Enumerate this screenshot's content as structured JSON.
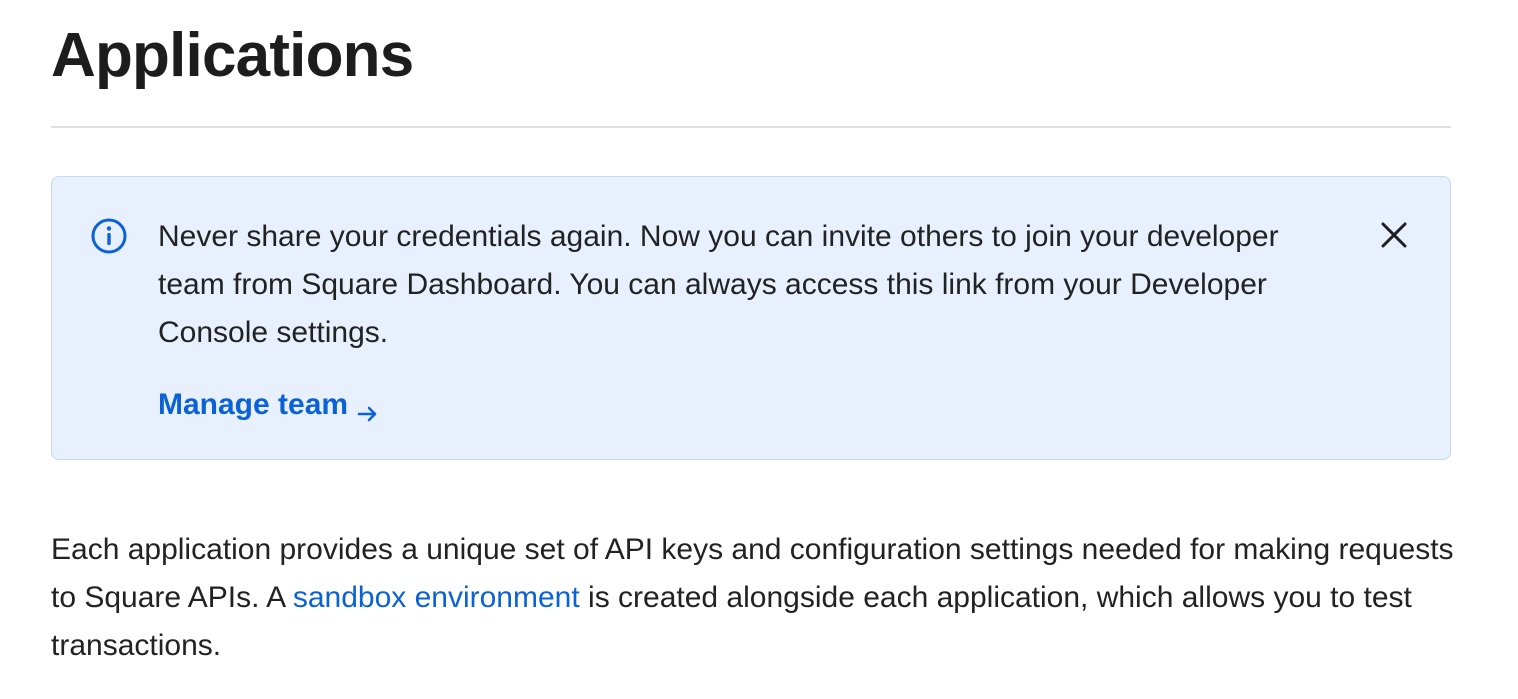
{
  "header": {
    "title": "Applications"
  },
  "banner": {
    "icon": "info-circle-icon",
    "message": "Never share your credentials again. Now you can invite others to join your developer team from Square Dashboard. You can always access this link from your Developer Console settings.",
    "link_label": "Manage team",
    "link_icon": "arrow-right-icon",
    "close_icon": "close-icon",
    "colors": {
      "background": "#e8f0fd",
      "border": "#c3d9f6",
      "accent": "#0b62d6"
    }
  },
  "description": {
    "before_link": "Each application provides a unique set of API keys and configuration settings needed for making requests to Square APIs. A ",
    "link_text": "sandbox environment",
    "after_link": " is created alongside each application, which allows you to test transactions."
  }
}
